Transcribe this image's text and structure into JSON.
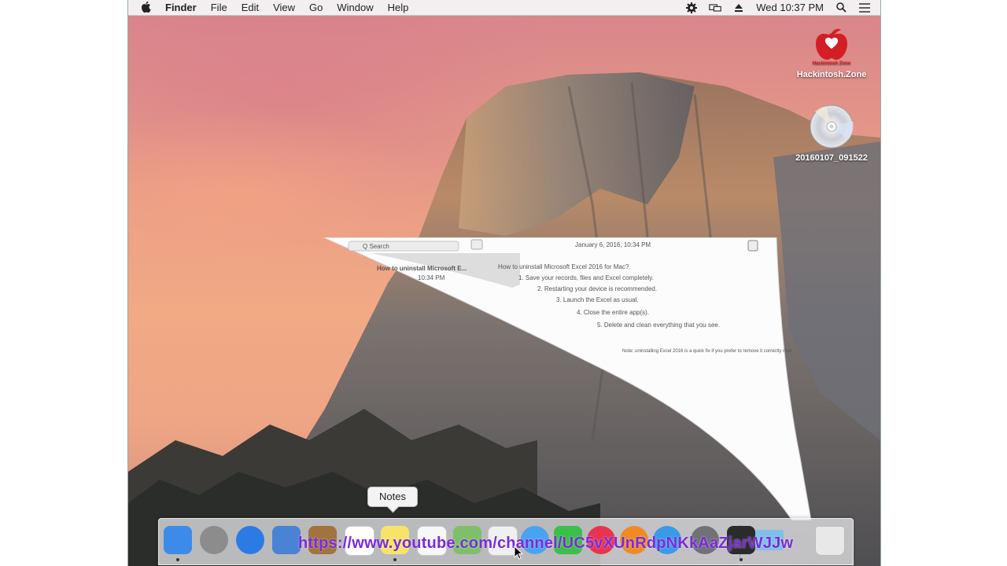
{
  "menubar": {
    "apple_icon": "apple-logo-icon",
    "app_name": "Finder",
    "menus": [
      "File",
      "Edit",
      "View",
      "Go",
      "Window",
      "Help"
    ],
    "clock": "Wed 10:37 PM",
    "status_icons": [
      "gear-icon",
      "display-icon",
      "eject-icon",
      "search-icon",
      "list-icon"
    ]
  },
  "desktop": {
    "items": [
      {
        "label": "Hackintosh.Zone",
        "icon": "hackintosh-zone-logo-icon",
        "logo_text": "Hackintosh Zone"
      },
      {
        "label": "20160107_091522",
        "icon": "dvd-disc-icon"
      }
    ]
  },
  "notes_window": {
    "search_placeholder": "Q Search",
    "date": "January 6, 2016, 10:34 PM",
    "list_item": "How to uninstall Microsoft E...",
    "list_item_time": "10:34 PM",
    "note_lines": [
      "How to uninstall Microsoft Excel 2016 for Mac?",
      "1. Save your records, files and Excel completely.",
      "2. Restarting your device is recommended.",
      "3. Launch the Excel as usual.",
      "4. Close the entire app(s).",
      "5. Delete and clean everything that you see.",
      "Note: uninstalling Excel 2016 is a quick fix if you prefer to remove it correctly now"
    ]
  },
  "dock": {
    "tooltip": "Notes",
    "apps": [
      {
        "name": "Finder",
        "icon": "finder-icon",
        "color": "#3d8be8",
        "running": true
      },
      {
        "name": "Launchpad",
        "icon": "launchpad-icon",
        "color": "#8c8c8c",
        "running": false
      },
      {
        "name": "Safari",
        "icon": "safari-icon",
        "color": "#2c7be5",
        "running": false
      },
      {
        "name": "Mail",
        "icon": "mail-icon",
        "color": "#4a83d4",
        "running": false
      },
      {
        "name": "Contacts",
        "icon": "contacts-icon",
        "color": "#a0743c",
        "running": false
      },
      {
        "name": "Calendar",
        "icon": "calendar-icon",
        "color": "#ffffff",
        "running": false
      },
      {
        "name": "Notes",
        "icon": "notes-icon",
        "color": "#f7e36a",
        "running": true
      },
      {
        "name": "Reminders",
        "icon": "reminders-icon",
        "color": "#f7f7f7",
        "running": false
      },
      {
        "name": "Maps",
        "icon": "maps-icon",
        "color": "#7ec06a",
        "running": false
      },
      {
        "name": "Photos",
        "icon": "photos-icon",
        "color": "#f0f0f0",
        "running": false
      },
      {
        "name": "Messages",
        "icon": "messages-icon",
        "color": "#4aa3f0",
        "running": false
      },
      {
        "name": "FaceTime",
        "icon": "facetime-icon",
        "color": "#3bbf4a",
        "running": false
      },
      {
        "name": "iTunes",
        "icon": "itunes-icon",
        "color": "#e8344e",
        "running": false
      },
      {
        "name": "iBooks",
        "icon": "ibooks-icon",
        "color": "#f08a24",
        "running": false
      },
      {
        "name": "App Store",
        "icon": "app-store-icon",
        "color": "#3a9ae8",
        "running": false
      },
      {
        "name": "System Preferences",
        "icon": "system-preferences-icon",
        "color": "#707278",
        "running": false
      },
      {
        "name": "Activity Monitor",
        "icon": "activity-monitor-icon",
        "color": "#2b2b2b",
        "running": true
      },
      {
        "name": "Downloads",
        "icon": "downloads-folder-icon",
        "color": "#7fbfea",
        "running": false
      },
      {
        "name": "Trash",
        "icon": "trash-icon",
        "color": "#e8e8e8",
        "running": false
      }
    ]
  },
  "overlay": {
    "watermark_url": "https://www.youtube.com/channel/UC5vXUnRdpNKkAaZjarWJJw"
  }
}
